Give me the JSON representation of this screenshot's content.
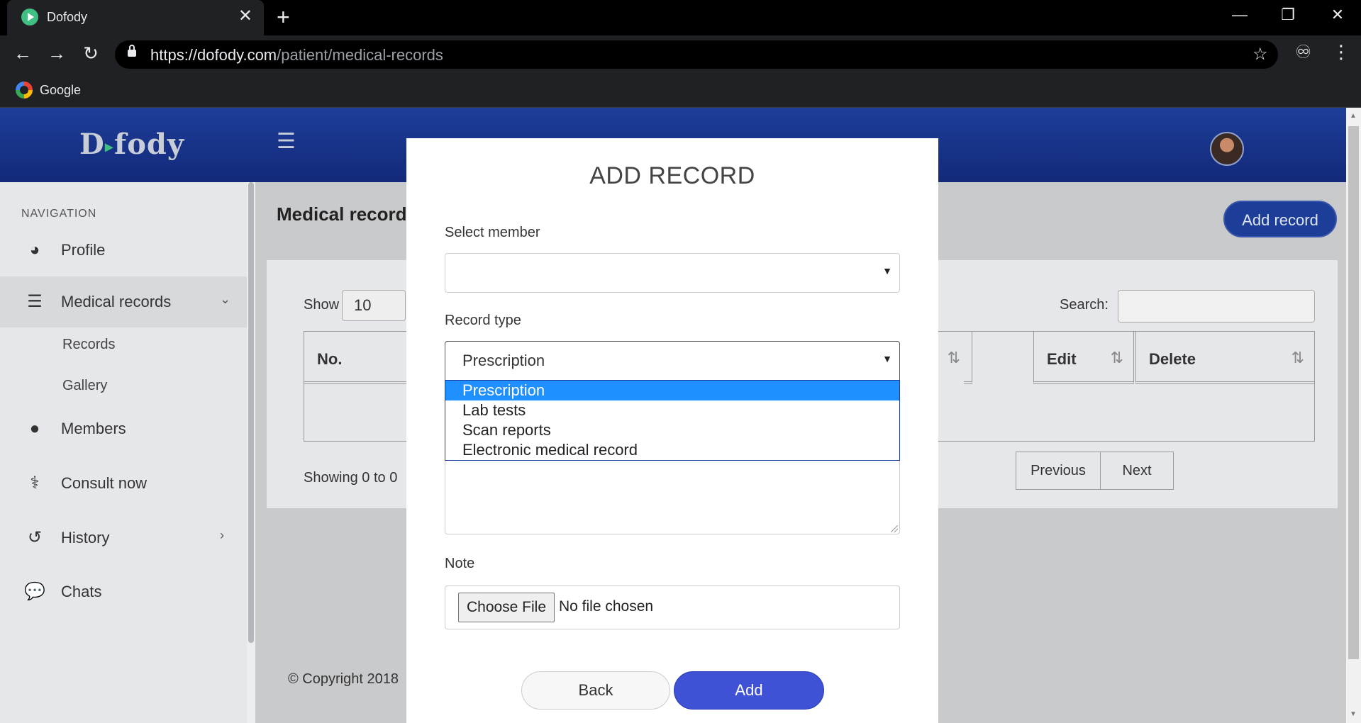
{
  "browser": {
    "tab_title": "Dofody",
    "tab_close": "✕",
    "new_tab": "+",
    "url_host": "https://dofody.com",
    "url_path": "/patient/medical-records",
    "bookmark_label": "Google"
  },
  "app": {
    "logo_left": "D",
    "logo_right": "fody",
    "nav_heading": "NAVIGATION",
    "nav": [
      {
        "label": "Profile",
        "icon": "dashboard-icon"
      },
      {
        "label": "Medical records",
        "icon": "list-icon"
      },
      {
        "label": "Members",
        "icon": "user-icon"
      },
      {
        "label": "Consult now",
        "icon": "stethoscope-icon"
      },
      {
        "label": "History",
        "icon": "history-icon"
      },
      {
        "label": "Chats",
        "icon": "chat-icon"
      }
    ],
    "sub_nav": [
      "Records",
      "Gallery"
    ],
    "page_title": "Medical records",
    "add_record_label": "Add record",
    "table": {
      "show_label": "Show",
      "show_value": "10",
      "search_label": "Search:",
      "headers": [
        "No.",
        "Edit",
        "Delete"
      ],
      "showing_text": "Showing 0 to 0",
      "pager": [
        "Previous",
        "Next"
      ]
    },
    "footer": "© Copyright 2018"
  },
  "modal": {
    "title": "ADD RECORD",
    "select_member_label": "Select member",
    "select_member_value": "",
    "record_type_label": "Record type",
    "record_type_value": "Prescription",
    "record_type_options": [
      "Prescription",
      "Lab tests",
      "Scan reports",
      "Electronic medical record"
    ],
    "note_label": "Note",
    "choose_file_label": "Choose File",
    "no_file_text": "No file chosen",
    "back_label": "Back",
    "add_label": "Add"
  },
  "colors": {
    "header": "#1d3e98",
    "accent_button": "#3f51d4",
    "dropdown_highlight": "#1e90ff",
    "logo_play": "#3fbf83"
  }
}
